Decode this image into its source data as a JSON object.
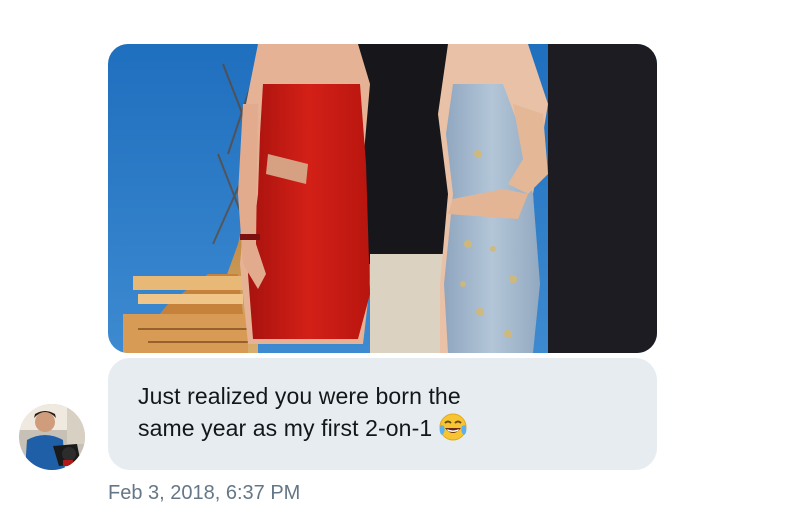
{
  "message": {
    "text_lines": [
      "Just realized you were born the",
      "same year as my first 2-on-1"
    ],
    "emoji": "face-with-tears-of-joy-icon",
    "timestamp": "Feb 3, 2018, 6:37 PM"
  },
  "sender": {
    "avatar": "avatar-photo"
  },
  "attachment": {
    "type": "photo"
  },
  "colors": {
    "bubble_background": "#e6ecf0",
    "message_text": "#14171a",
    "timestamp_text": "#657786"
  }
}
